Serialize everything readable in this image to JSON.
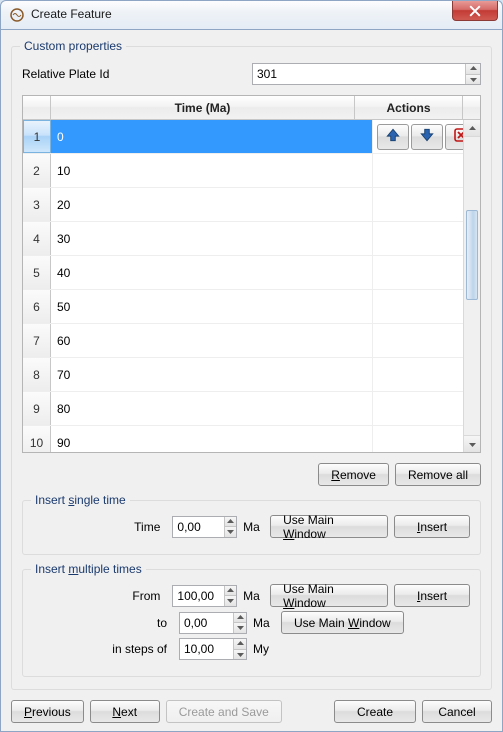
{
  "window": {
    "title": "Create Feature"
  },
  "groupbox": {
    "custom_properties": "Custom properties",
    "relative_plate_label": "Relative Plate Id",
    "relative_plate_value": "301",
    "insert_single": "Insert single time",
    "insert_multiple": "Insert multiple times"
  },
  "table": {
    "header_time": "Time (Ma)",
    "header_actions": "Actions",
    "rows": [
      {
        "n": "1",
        "time": "0",
        "selected": true
      },
      {
        "n": "2",
        "time": "10"
      },
      {
        "n": "3",
        "time": "20"
      },
      {
        "n": "4",
        "time": "30"
      },
      {
        "n": "5",
        "time": "40"
      },
      {
        "n": "6",
        "time": "50"
      },
      {
        "n": "7",
        "time": "60"
      },
      {
        "n": "8",
        "time": "70"
      },
      {
        "n": "9",
        "time": "80"
      },
      {
        "n": "10",
        "time": "90"
      }
    ]
  },
  "buttons": {
    "remove": "Remove",
    "remove_all": "Remove all",
    "use_main_window": "Use Main Window",
    "insert": "Insert",
    "previous": "Previous",
    "next": "Next",
    "create_and_save": "Create and Save",
    "create": "Create",
    "cancel": "Cancel"
  },
  "single": {
    "time_label": "Time",
    "value": "0,00",
    "unit": "Ma"
  },
  "multiple": {
    "from_label": "From",
    "from_value": "100,00",
    "to_label": "to",
    "to_value": "0,00",
    "unit": "Ma",
    "step_label": "in steps of",
    "step_value": "10,00",
    "step_unit": "My"
  },
  "underline": {
    "single": "s",
    "multiple": "m",
    "window": "W",
    "insert": "I",
    "previous": "P",
    "next": "N",
    "remove": "R"
  }
}
